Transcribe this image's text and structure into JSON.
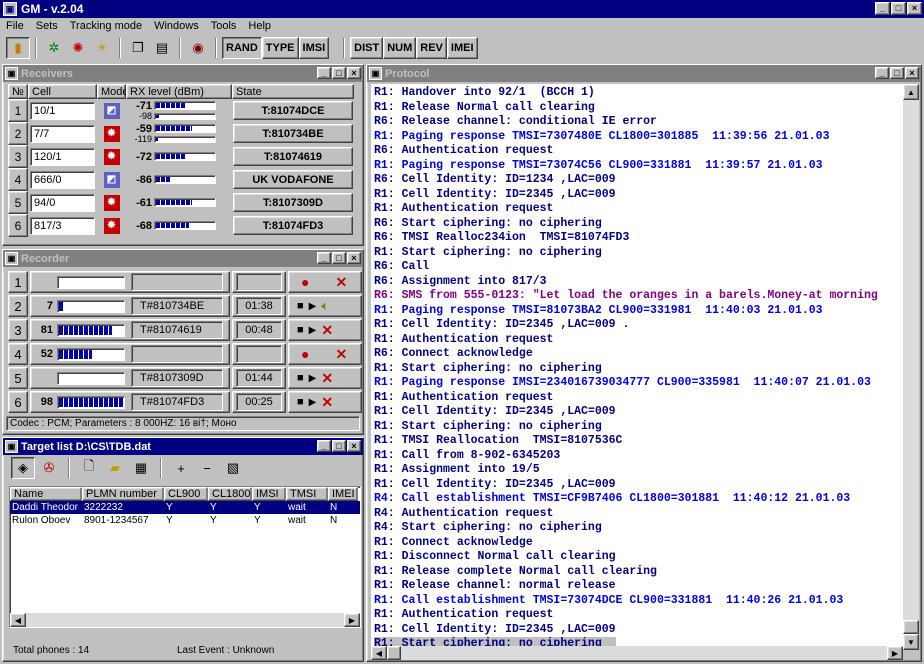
{
  "window": {
    "title": "GM - v.2.04",
    "min": "_",
    "max": "□",
    "close": "×"
  },
  "menu": [
    "File",
    "Sets",
    "Tracking mode",
    "Windows",
    "Tools",
    "Help"
  ],
  "toolbar": {
    "mode_buttons": [
      "RAND",
      "TYPE",
      "IMSI"
    ],
    "view_buttons": [
      "DIST",
      "NUM",
      "REV",
      "IMEI"
    ]
  },
  "receivers": {
    "title": "Receivers",
    "columns": [
      "№",
      "Cell",
      "Mode",
      "RX level (dBm)",
      "State"
    ],
    "rows": [
      {
        "n": "1",
        "cell": "10/1",
        "level": "-71",
        "level2": "-98",
        "bar": 0.5,
        "bar2": 0.05,
        "state": "T:81074DCE"
      },
      {
        "n": "2",
        "cell": "7/7",
        "level": "-59",
        "level2": "-119",
        "bar": 0.6,
        "bar2": 0.02,
        "state": "T:810734BE"
      },
      {
        "n": "3",
        "cell": "120/1",
        "level": "-72",
        "level2": "",
        "bar": 0.5,
        "bar2": 0,
        "state": "T:81074619"
      },
      {
        "n": "4",
        "cell": "666/0",
        "level": "-86",
        "level2": "",
        "bar": 0.25,
        "bar2": 0,
        "state": "UK VODAFONE"
      },
      {
        "n": "5",
        "cell": "94/0",
        "level": "-61",
        "level2": "",
        "bar": 0.6,
        "bar2": 0,
        "state": "T:8107309D"
      },
      {
        "n": "6",
        "cell": "817/3",
        "level": "-68",
        "level2": "",
        "bar": 0.55,
        "bar2": 0,
        "state": "T:81074FD3"
      }
    ]
  },
  "recorder": {
    "title": "Recorder",
    "rows": [
      {
        "n": "1",
        "count": "",
        "bar": 0,
        "tmsi": "",
        "time": "",
        "stop": false,
        "play": false,
        "active": false
      },
      {
        "n": "2",
        "count": "7",
        "bar": 0.08,
        "tmsi": "T#810734BE",
        "time": "01:38",
        "stop": true,
        "play": true,
        "active": true
      },
      {
        "n": "3",
        "count": "81",
        "bar": 0.8,
        "tmsi": "T#81074619",
        "time": "00:48",
        "stop": true,
        "play": true,
        "active": false
      },
      {
        "n": "4",
        "count": "52",
        "bar": 0.5,
        "tmsi": "",
        "time": "",
        "stop": false,
        "play": false,
        "active": false
      },
      {
        "n": "5",
        "count": "",
        "bar": 0,
        "tmsi": "T#8107309D",
        "time": "01:44",
        "stop": true,
        "play": true,
        "active": false
      },
      {
        "n": "6",
        "count": "98",
        "bar": 0.98,
        "tmsi": "T#81074FD3",
        "time": "00:25",
        "stop": true,
        "play": true,
        "active": false
      }
    ],
    "codec": "Codec : PCM; Parameters : 8 000HZ: 16 ві†; Моно"
  },
  "targets": {
    "title": "Target list D:\\CS\\TDB.dat",
    "columns": [
      "Name",
      "PLMN number",
      "CL900",
      "CL1800",
      "IMSI",
      "TMSI",
      "IMEI"
    ],
    "rows": [
      [
        "Daddi Theodor",
        "3222232",
        "Y",
        "Y",
        "Y",
        "wait",
        "N"
      ],
      [
        "Rulon Oboev",
        "8901-1234567",
        "Y",
        "Y",
        "Y",
        "wait",
        "N"
      ]
    ],
    "total": "Total phones : 14",
    "last_event": "Last Event : Unknown"
  },
  "protocol": {
    "title": "Protocol",
    "lines": [
      {
        "t": "R1: Handover into 92/1  (BCCH 1)",
        "c": "#000080"
      },
      {
        "t": "R1: Release Normal call clearing",
        "c": "#000080"
      },
      {
        "t": "R6: Release channel: conditional IE error",
        "c": "#000080"
      },
      {
        "t": "R1: Paging response TMSI=7307480E CL1800=301885  11:39:56 21.01.03",
        "c": "#0000e0"
      },
      {
        "t": "R6: Authentication request",
        "c": "#000080"
      },
      {
        "t": "R1: Paging response TMSI=73074C56 CL900=331881  11:39:57 21.01.03",
        "c": "#0000e0"
      },
      {
        "t": "R6: Cell Identity: ID=1234 ,LAC=009",
        "c": "#000080"
      },
      {
        "t": "R1: Cell Identity: ID=2345 ,LAC=009",
        "c": "#000080"
      },
      {
        "t": "R1: Authentication request",
        "c": "#000080"
      },
      {
        "t": "R6: Start ciphering: no ciphering",
        "c": "#000080"
      },
      {
        "t": "R6: TMSI Realloc234ion  TMSI=81074FD3",
        "c": "#000080"
      },
      {
        "t": "R1: Start ciphering: no ciphering",
        "c": "#000080"
      },
      {
        "t": "R6: Call",
        "c": "#000080"
      },
      {
        "t": "R6: Assignment into 817/3",
        "c": "#000080"
      },
      {
        "t": "R6: SMS from 555-0123: \"Let load the oranges in a barels.Money-at morning",
        "c": "#800080"
      },
      {
        "t": "R1: Paging response TMSI=81073BA2 CL900=331981  11:40:03 21.01.03",
        "c": "#0000e0"
      },
      {
        "t": "R1: Cell Identity: ID=2345 ,LAC=009 .",
        "c": "#000080"
      },
      {
        "t": "R1: Authentication request",
        "c": "#000080"
      },
      {
        "t": "R6: Connect acknowledge",
        "c": "#000080"
      },
      {
        "t": "R1: Start ciphering: no ciphering",
        "c": "#000080"
      },
      {
        "t": "R1: Paging response IMSI=234016739034777 CL900=335981  11:40:07 21.01.03",
        "c": "#0000e0"
      },
      {
        "t": "R1: Authentication request",
        "c": "#000080"
      },
      {
        "t": "R1: Cell Identity: ID=2345 ,LAC=009",
        "c": "#000080"
      },
      {
        "t": "R1: Start ciphering: no ciphering",
        "c": "#000080"
      },
      {
        "t": "R1: TMSI Reallocation  TMSI=8107536C",
        "c": "#000080"
      },
      {
        "t": "R1: Call from 8-902-6345203",
        "c": "#000080"
      },
      {
        "t": "R1: Assignment into 19/5",
        "c": "#000080"
      },
      {
        "t": "R1: Cell Identity: ID=2345 ,LAC=009",
        "c": "#000080"
      },
      {
        "t": "R4: Call establishment TMSI=CF9B7406 CL1800=301881  11:40:12 21.01.03",
        "c": "#0000e0"
      },
      {
        "t": "R4: Authentication request",
        "c": "#000080"
      },
      {
        "t": "R4: Start ciphering: no ciphering",
        "c": "#000080"
      },
      {
        "t": "R1: Connect acknowledge",
        "c": "#000080"
      },
      {
        "t": "R1: Disconnect Normal call clearing",
        "c": "#000080"
      },
      {
        "t": "R1: Release complete Normal call clearing",
        "c": "#000080"
      },
      {
        "t": "R1: Release channel: normal release",
        "c": "#000080"
      },
      {
        "t": "R1: Call establishment TMSI=73074DCE CL900=331881  11:40:26 21.01.03",
        "c": "#0000e0"
      },
      {
        "t": "R1: Authentication request",
        "c": "#000080"
      },
      {
        "t": "R1: Cell Identity: ID=2345 ,LAC=009",
        "c": "#000080"
      },
      {
        "t": "R1: Start ciphering: no ciphering",
        "c": "#000080",
        "hl": true
      }
    ]
  }
}
